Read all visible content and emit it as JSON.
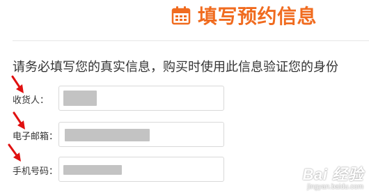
{
  "header": {
    "title": "填写预约信息",
    "icon": "calendar-icon",
    "accent_color": "#f06b1f"
  },
  "notice": "请务必填写您的真实信息，购买时使用此信息验证您的身份",
  "form": {
    "fields": [
      {
        "label": "收货人：",
        "value": "",
        "state": "redacted"
      },
      {
        "label": "电子邮箱：",
        "value": "",
        "state": "redacted"
      },
      {
        "label": "手机号码：",
        "value": "",
        "state": "redacted"
      }
    ]
  },
  "annotations": {
    "arrow_color": "#e01010",
    "icon": "red-arrow-icon"
  },
  "watermark": {
    "logo": "Bai 经验",
    "url": "jingyan.baidu.com"
  }
}
